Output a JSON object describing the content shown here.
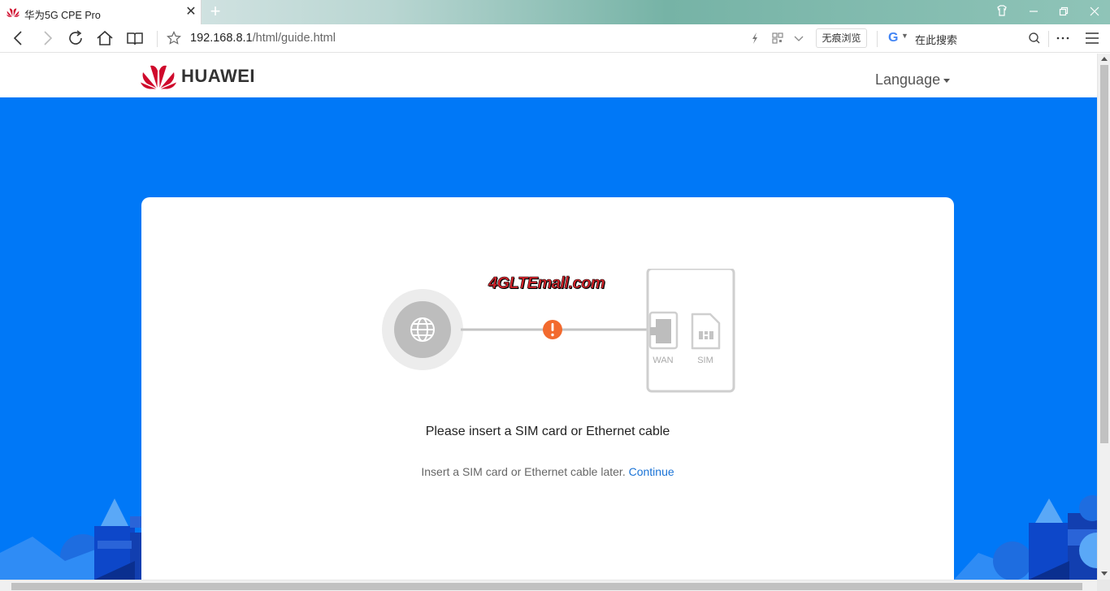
{
  "browser": {
    "tab": {
      "title": "华为5G CPE Pro",
      "close": "✕"
    },
    "new_tab": "+",
    "window_controls": [
      "skin-icon",
      "minimize-icon",
      "restore-icon",
      "close-icon"
    ],
    "address": {
      "host": "192.168.8.1",
      "path": "/html/guide.html"
    },
    "incognito_label": "无痕浏览",
    "search": {
      "engine_glyph": "G",
      "placeholder": "在此搜索"
    }
  },
  "header": {
    "brand": "HUAWEI",
    "language_label": "Language"
  },
  "guide": {
    "watermark": "4GLTEmall.com",
    "ports": {
      "wan": "WAN",
      "sim": "SIM"
    },
    "alert_glyph": "!",
    "headline": "Please insert a SIM card or Ethernet cable",
    "subline": "Insert a SIM card or Ethernet cable later.",
    "continue_link": "Continue"
  },
  "colors": {
    "page_bg": "#0078f7",
    "huawei_red": "#cf0a2c",
    "alert": "#f26a2e",
    "link": "#1a73d6"
  }
}
